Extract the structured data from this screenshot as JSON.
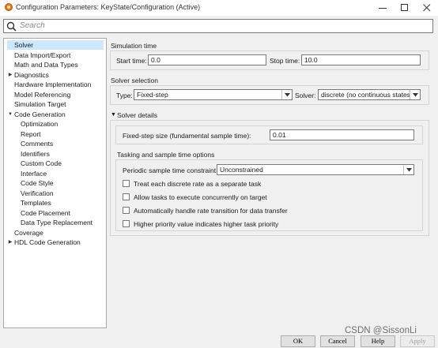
{
  "window": {
    "title": "Configuration Parameters: KeyState/Configuration (Active)"
  },
  "search": {
    "placeholder": "Search"
  },
  "tree": {
    "items": [
      {
        "label": "Solver"
      },
      {
        "label": "Data Import/Export"
      },
      {
        "label": "Math and Data Types"
      },
      {
        "label": "Diagnostics"
      },
      {
        "label": "Hardware Implementation"
      },
      {
        "label": "Model Referencing"
      },
      {
        "label": "Simulation Target"
      },
      {
        "label": "Code Generation"
      },
      {
        "label": "Optimization"
      },
      {
        "label": "Report"
      },
      {
        "label": "Comments"
      },
      {
        "label": "Identifiers"
      },
      {
        "label": "Custom Code"
      },
      {
        "label": "Interface"
      },
      {
        "label": "Code Style"
      },
      {
        "label": "Verification"
      },
      {
        "label": "Templates"
      },
      {
        "label": "Code Placement"
      },
      {
        "label": "Data Type Replacement"
      },
      {
        "label": "Coverage"
      },
      {
        "label": "HDL Code Generation"
      }
    ]
  },
  "simulation_time": {
    "title": "Simulation time",
    "start_label": "Start time:",
    "start_value": "0.0",
    "stop_label": "Stop time:",
    "stop_value": "10.0"
  },
  "solver_selection": {
    "title": "Solver selection",
    "type_label": "Type:",
    "type_value": "Fixed-step",
    "solver_label": "Solver:",
    "solver_value": "discrete (no continuous states)"
  },
  "solver_details": {
    "title": "Solver details",
    "step_label": "Fixed-step size (fundamental sample time):",
    "step_value": "0.01"
  },
  "tasking": {
    "title": "Tasking and sample time options",
    "periodic_label": "Periodic sample time constraint:",
    "periodic_value": "Unconstrained",
    "checkboxes": [
      {
        "label": "Treat each discrete rate as a separate task",
        "checked": false
      },
      {
        "label": "Allow tasks to execute concurrently on target",
        "checked": false
      },
      {
        "label": "Automatically handle rate transition for data transfer",
        "checked": false
      },
      {
        "label": "Higher priority value indicates higher task priority",
        "checked": false
      }
    ]
  },
  "buttons": {
    "ok": "OK",
    "cancel": "Cancel",
    "help": "Help",
    "apply": "Apply"
  },
  "watermark": "CSDN @SissonLi",
  "colors": {
    "selection": "#cce8ff",
    "app_icon": "#e07a18"
  }
}
